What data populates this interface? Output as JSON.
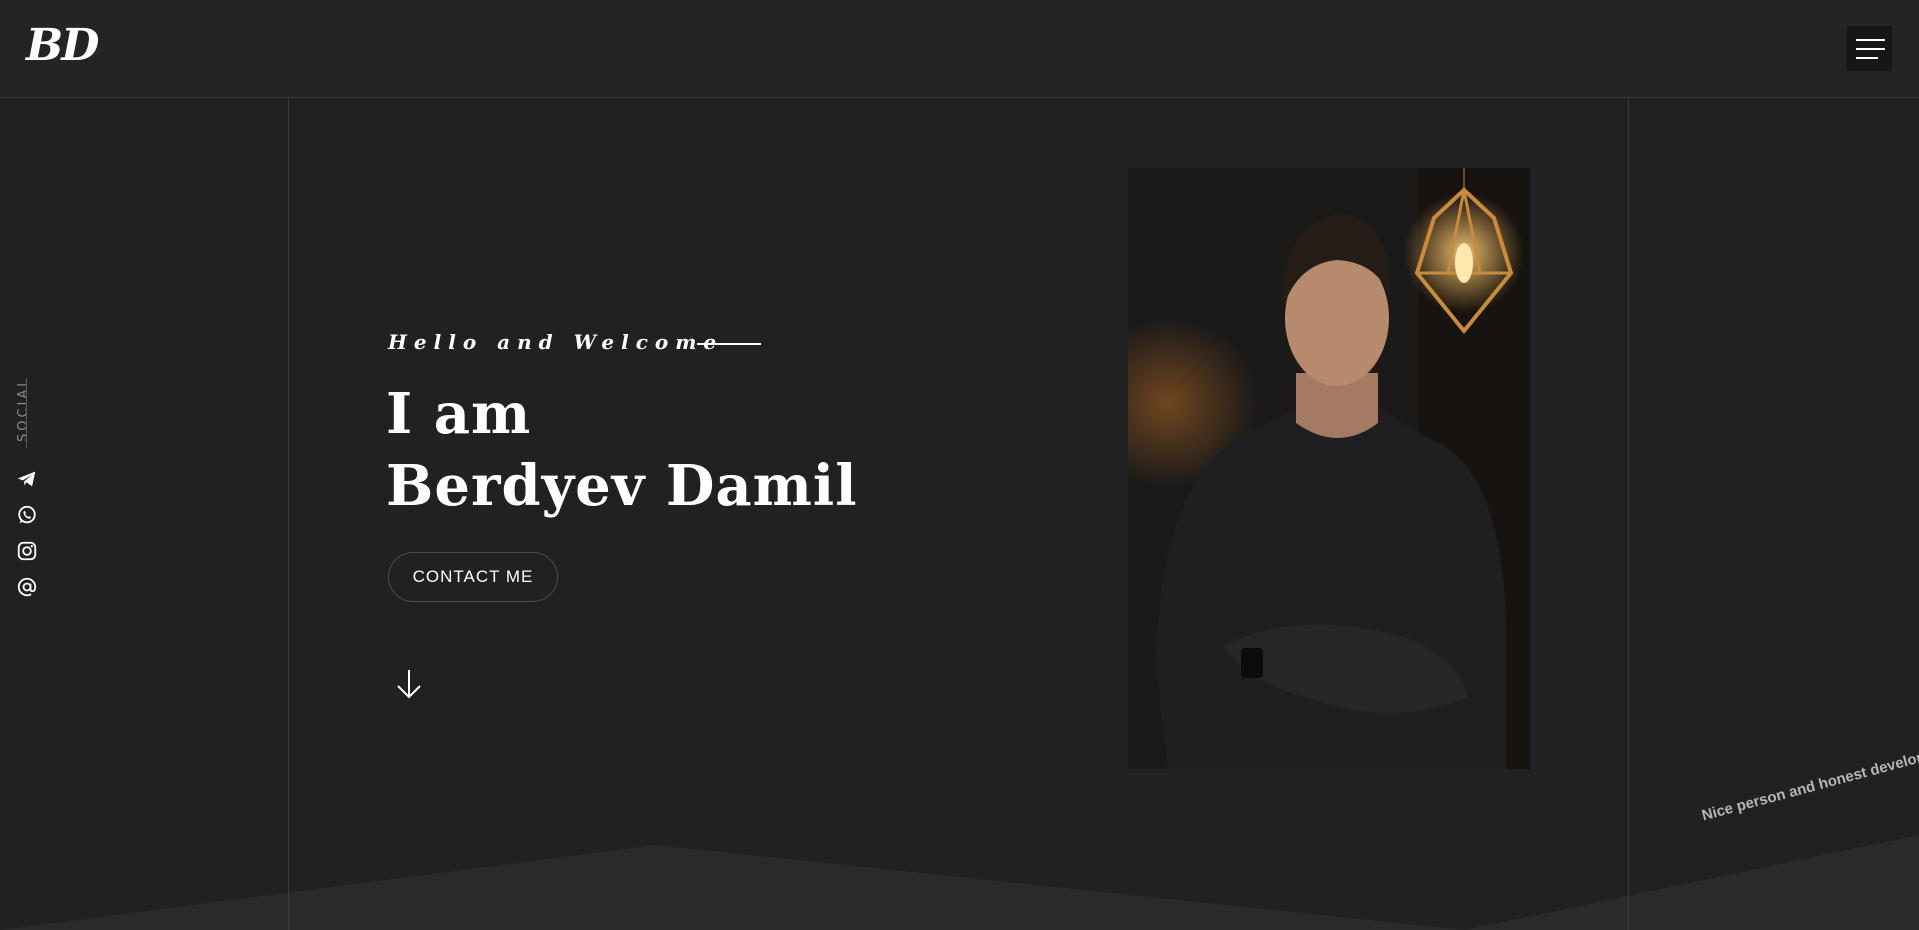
{
  "header": {
    "logo_text": "BD"
  },
  "social": {
    "label": "SOCIAL",
    "icons": [
      "telegram-icon",
      "whatsapp-icon",
      "instagram-icon",
      "at-email-icon"
    ]
  },
  "hero": {
    "greeting": "Hello and Welcome",
    "headline_line1": "I am",
    "headline_line2": "Berdyev Damil",
    "contact_button": "CONTACT ME"
  },
  "footer": {
    "tagline": "Nice person and honest developer"
  },
  "colors": {
    "background": "#212121",
    "header_bg": "#242424",
    "floor_shape": "#2a2a2a",
    "text": "#ffffff",
    "muted": "#8a8a8a"
  }
}
